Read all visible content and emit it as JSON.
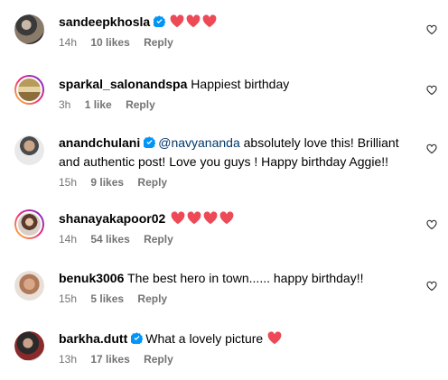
{
  "colors": {
    "heart": "#ed4956",
    "verified": "#0095f6",
    "meta": "#737373",
    "mention": "#00376b"
  },
  "comments": [
    {
      "username": "sandeepkhosla",
      "verified": true,
      "text": "",
      "hearts": 3,
      "time": "14h",
      "likes": "10 likes",
      "reply": "Reply",
      "story": false
    },
    {
      "username": "sparkal_salonandspa",
      "verified": false,
      "text": "Happiest birthday",
      "hearts": 0,
      "time": "3h",
      "likes": "1 like",
      "reply": "Reply",
      "story": true
    },
    {
      "username": "anandchulani",
      "verified": true,
      "mention": "@navyananda",
      "text": " absolutely love this! Brilliant and authentic post! Love you guys ! Happy birthday Aggie!!",
      "hearts": 0,
      "time": "15h",
      "likes": "9 likes",
      "reply": "Reply",
      "story": false
    },
    {
      "username": "shanayakapoor02",
      "verified": false,
      "text": "",
      "hearts": 4,
      "time": "14h",
      "likes": "54 likes",
      "reply": "Reply",
      "story": true
    },
    {
      "username": "benuk3006",
      "verified": false,
      "text": "The best hero in town...... happy birthday!!",
      "hearts": 0,
      "time": "15h",
      "likes": "5 likes",
      "reply": "Reply",
      "story": false
    },
    {
      "username": "barkha.dutt",
      "verified": true,
      "text": "What a lovely picture",
      "hearts": 1,
      "time": "13h",
      "likes": "17 likes",
      "reply": "Reply",
      "story": false
    }
  ]
}
